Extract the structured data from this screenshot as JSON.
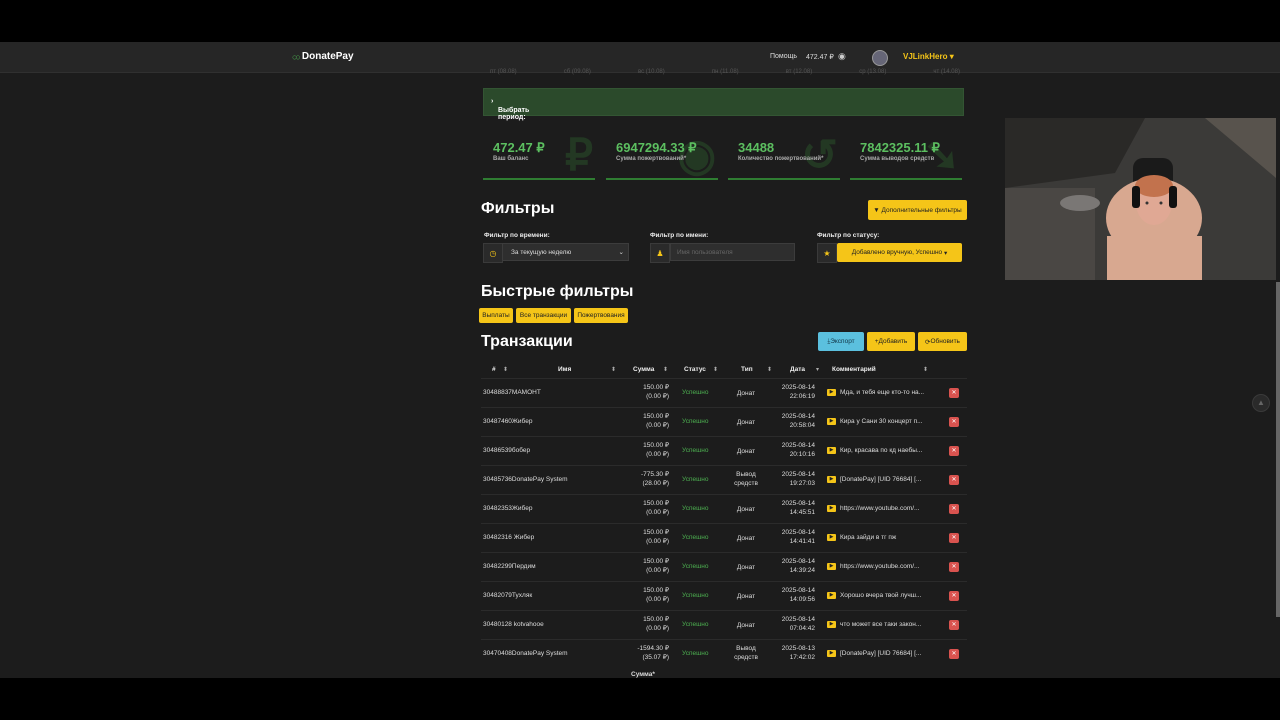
{
  "header": {
    "brand": "DonatePay",
    "help": "Помощь",
    "balance": "472.47 ₽",
    "username": "VJLinkHero"
  },
  "chart_ticks": [
    "пт (08.08)",
    "сб (09.08)",
    "вс (10.08)",
    "пн (11.08)",
    "вт (12.08)",
    "ср (13.08)",
    "чт (14.08)"
  ],
  "period": {
    "label": "Выбрать период:"
  },
  "stats": [
    {
      "value": "472.47 ₽",
      "label": "Ваш баланс",
      "glyph": "₽"
    },
    {
      "value": "6947294.33 ₽",
      "label": "Сумма пожертвований*",
      "glyph": "◉"
    },
    {
      "value": "34488",
      "label": "Количество пожертвований*",
      "glyph": "↺"
    },
    {
      "value": "7842325.11 ₽",
      "label": "Сумма выводов средств",
      "glyph": "➘"
    }
  ],
  "filters": {
    "title": "Фильтры",
    "more_button": "Дополнительные фильтры",
    "time_label": "Фильтр по времени:",
    "time_value": "За текущую неделю",
    "name_label": "Фильтр по имени:",
    "name_placeholder": "Имя пользователя",
    "status_label": "Фильтр по статусу:",
    "status_value": "Добавлено вручную, Успешно"
  },
  "quick": {
    "title": "Быстрые фильтры",
    "buttons": [
      "Выплаты",
      "Все транзакции",
      "Пожертвования"
    ]
  },
  "transactions": {
    "title": "Транзакции",
    "export": "Экспорт",
    "add": "Добавить",
    "refresh": "Обновить",
    "columns": [
      "#",
      "Имя",
      "Сумма",
      "Статус",
      "Тип",
      "Дата",
      "Комментарий"
    ],
    "rows": [
      {
        "id": "30488837МАМОНТ",
        "sum1": "150.00 ₽",
        "sum2": "(0.00 ₽)",
        "status": "Успешно",
        "type1": "Донат",
        "type2": "",
        "date1": "2025-08-14",
        "date2": "22:06:19",
        "comment": "Мда, и тебя еще кто-то на..."
      },
      {
        "id": "30487460Жибер",
        "sum1": "150.00 ₽",
        "sum2": "(0.00 ₽)",
        "status": "Успешно",
        "type1": "Донат",
        "type2": "",
        "date1": "2025-08-14",
        "date2": "20:58:04",
        "comment": "Кира у Сани 30 концерт п..."
      },
      {
        "id": "30486539бобер",
        "sum1": "150.00 ₽",
        "sum2": "(0.00 ₽)",
        "status": "Успешно",
        "type1": "Донат",
        "type2": "",
        "date1": "2025-08-14",
        "date2": "20:10:16",
        "comment": "Кир, красава по кд наебы..."
      },
      {
        "id": "30485736DonatePay System",
        "sum1": "-775.30 ₽",
        "sum2": "(28.00 ₽)",
        "status": "Успешно",
        "type1": "Вывод",
        "type2": "средств",
        "date1": "2025-08-14",
        "date2": "19:27:03",
        "comment": "[DonatePay] [UID 76684] [..."
      },
      {
        "id": "30482353Жибер",
        "sum1": "150.00 ₽",
        "sum2": "(0.00 ₽)",
        "status": "Успешно",
        "type1": "Донат",
        "type2": "",
        "date1": "2025-08-14",
        "date2": "14:45:51",
        "comment": "https://www.youtube.com/..."
      },
      {
        "id": "30482316 Жибер",
        "sum1": "150.00 ₽",
        "sum2": "(0.00 ₽)",
        "status": "Успешно",
        "type1": "Донат",
        "type2": "",
        "date1": "2025-08-14",
        "date2": "14:41:41",
        "comment": "Кира зайди в тг пж"
      },
      {
        "id": "30482299Пердим",
        "sum1": "150.00 ₽",
        "sum2": "(0.00 ₽)",
        "status": "Успешно",
        "type1": "Донат",
        "type2": "",
        "date1": "2025-08-14",
        "date2": "14:39:24",
        "comment": "https://www.youtube.com/..."
      },
      {
        "id": "30482079Тухляк",
        "sum1": "150.00 ₽",
        "sum2": "(0.00 ₽)",
        "status": "Успешно",
        "type1": "Донат",
        "type2": "",
        "date1": "2025-08-14",
        "date2": "14:09:56",
        "comment": "Хорошо вчера твой лучш..."
      },
      {
        "id": "30480128 kotvahooe",
        "sum1": "150.00 ₽",
        "sum2": "(0.00 ₽)",
        "status": "Успешно",
        "type1": "Донат",
        "type2": "",
        "date1": "2025-08-14",
        "date2": "07:04:42",
        "comment": "что может все таки закон..."
      },
      {
        "id": "30470408DonatePay System",
        "sum1": "-1594.30 ₽",
        "sum2": "(35.07 ₽)",
        "status": "Успешно",
        "type1": "Вывод",
        "type2": "средств",
        "date1": "2025-08-13",
        "date2": "17:42:02",
        "comment": "[DonatePay] [UID 76684] [..."
      }
    ],
    "footer_cut": "Сумма*"
  },
  "icons": {
    "eye": "eye-icon",
    "youtube": "youtube-icon",
    "delete": "trash-icon"
  },
  "colors": {
    "accent": "#f5c518",
    "green": "#4caf50",
    "danger": "#d9534f",
    "info": "#5bc0de"
  }
}
